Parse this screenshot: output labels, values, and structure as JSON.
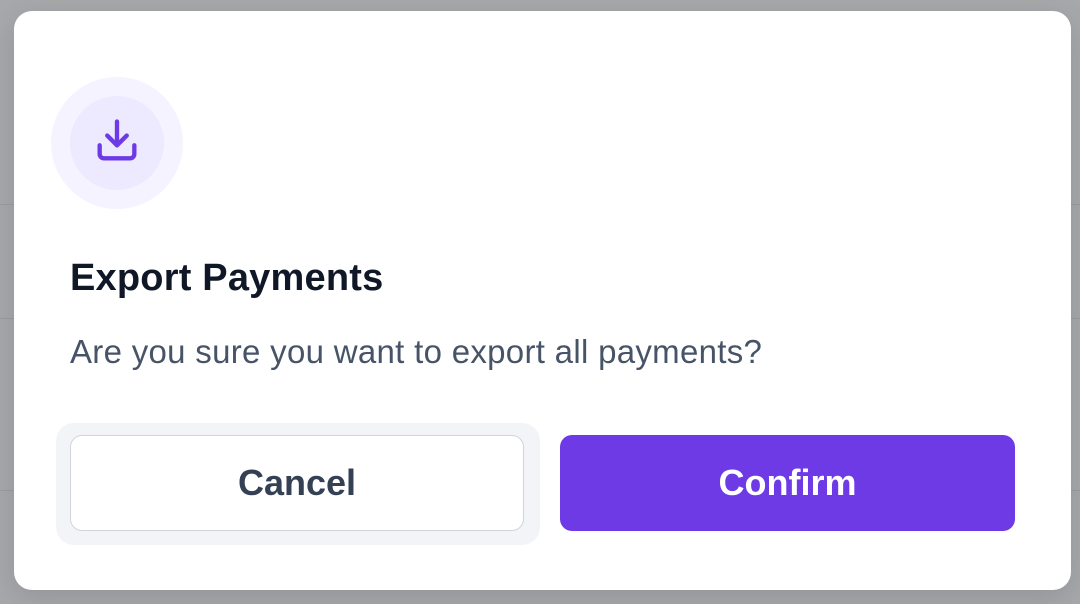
{
  "modal": {
    "title": "Export Payments",
    "message": "Are you sure you want to export all payments?",
    "icon": "download-icon",
    "cancel_label": "Cancel",
    "confirm_label": "Confirm"
  },
  "colors": {
    "accent": "#6d3ae6",
    "icon_bg_outer": "#f5f3ff",
    "icon_bg_inner": "#ede9fe",
    "overlay": "#a6a8ab"
  }
}
